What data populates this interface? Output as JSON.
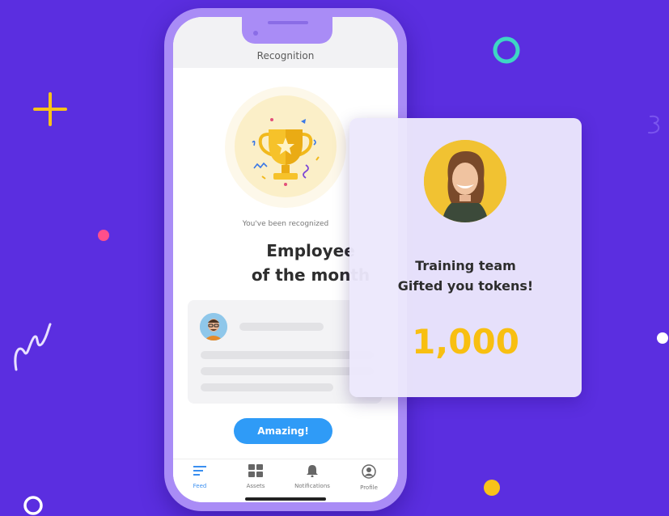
{
  "screen": {
    "title": "Recognition",
    "recognized_subtitle": "You've been recognized",
    "award_line1": "Employee",
    "award_line2": "of the month",
    "action_button": "Amazing!"
  },
  "tabbar": {
    "items": [
      {
        "label": "Feed",
        "icon": "feed-icon",
        "active": true
      },
      {
        "label": "Assets",
        "icon": "grid-icon",
        "active": false
      },
      {
        "label": "Notifications",
        "icon": "bell-icon",
        "active": false
      },
      {
        "label": "Profile",
        "icon": "user-icon",
        "active": false
      }
    ]
  },
  "token_card": {
    "line1": "Training team",
    "line2": "Gifted you tokens!",
    "amount": "1,000"
  },
  "colors": {
    "background": "#5b2ee0",
    "phone_frame": "#a98cf6",
    "accent_blue": "#2f9bf7",
    "token_yellow": "#f8bf11",
    "trophy_gold": "#f1b91c"
  }
}
